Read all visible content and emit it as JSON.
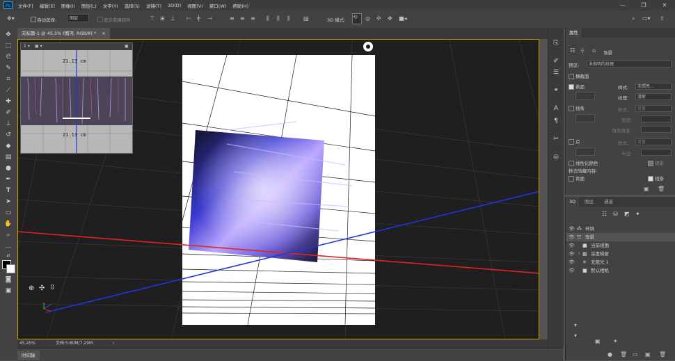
{
  "menubar": {
    "logo": "Ps",
    "items": [
      "文件(F)",
      "编辑(E)",
      "图像(I)",
      "图层(L)",
      "文字(Y)",
      "选择(S)",
      "滤镜(T)",
      "3D(D)",
      "视图(V)",
      "窗口(W)",
      "帮助(H)"
    ],
    "minimize": "—",
    "restore": "❐",
    "close": "✕"
  },
  "options": {
    "auto_select_label": "自动选择:",
    "auto_select_value": "图层",
    "show_transform_label": "显示变换控件",
    "mode_3d_label": "3D 模式:"
  },
  "tab": {
    "title": "未标题-1 @ 45.5% (图河, RGB/8) *",
    "close": "×"
  },
  "minimap": {
    "top_label": "21.13 cm",
    "bottom_label": "21.13 cm"
  },
  "status": {
    "zoom": "45.45%",
    "doc": "文档:5.80M/7.29M",
    "arrow": "›"
  },
  "timeline": {
    "label": "时间轴"
  },
  "properties": {
    "title": "属性",
    "subtitle": "场景",
    "preset_label": "预设:",
    "preset_value": "未指明的纹理",
    "cross_section": "横截面",
    "surface": "表面",
    "style_label": "样式:",
    "style_value": "未照亮...",
    "texture_label": "纹理:",
    "texture_value": "漫射",
    "lines": "线条",
    "lines_style_label": "样式:",
    "lines_style_value": "常量",
    "width_label": "宽度:",
    "angle_label": "角度阈值:",
    "points": "点",
    "points_style_label": "样式:",
    "points_style_value": "常量",
    "radius_label": "半径:",
    "linearize": "线性化颜色",
    "shadow": "阴影",
    "remove_hidden": "移去隐藏内容:",
    "backface": "背面",
    "lines_check": "线条"
  },
  "panel3d": {
    "tabs": [
      "3D",
      "图层",
      "通道"
    ],
    "items": [
      {
        "label": "环境",
        "indent": 0
      },
      {
        "label": "场景",
        "indent": 0
      },
      {
        "label": "当前视图",
        "indent": 1
      },
      {
        "label": "深度映射",
        "indent": 1
      },
      {
        "label": "无限光 1",
        "indent": 1
      },
      {
        "label": "默认相机",
        "indent": 1
      }
    ]
  },
  "colors": {
    "accent_border": "#c8a400",
    "x_axis": "#e02424",
    "z_axis": "#2433e0",
    "y_axis": "#3a5ccc"
  }
}
